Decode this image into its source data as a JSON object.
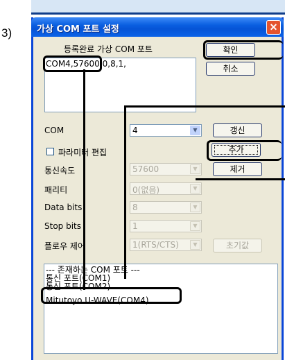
{
  "step_label": "3)",
  "window": {
    "title": "가상 COM 포트 설정",
    "close_glyph": "✕"
  },
  "registered": {
    "header": "등록완료 가상 COM 포트",
    "items": [
      "COM4,57600,0,8,1,"
    ]
  },
  "buttons": {
    "ok": "확인",
    "cancel": "취소",
    "refresh": "갱신",
    "add": "추가",
    "remove": "제거",
    "reset": "초기값"
  },
  "form": {
    "com_label": "COM",
    "com_value": "4",
    "param_edit_label": "파라미터 편집",
    "param_edit_checked": false,
    "baud_label": "통신속도",
    "baud_value": "57600",
    "parity_label": "패리티",
    "parity_value": "0(없음)",
    "databits_label": "Data bits",
    "databits_value": "8",
    "stopbits_label": "Stop bits",
    "stopbits_value": "1",
    "flow_label": "플로우 제어",
    "flow_value": "1(RTS/CTS)"
  },
  "ports": {
    "items": [
      "--- 존재하는 COM 포트 ---",
      "통신 포트(COM1)",
      "통신 포트(COM2)",
      "Mitutoyo U-WAVE(COM4)"
    ]
  },
  "colors": {
    "titlebar": "#0a5fe0",
    "dialog_bg": "#ece9d8",
    "close": "#e4542e"
  }
}
